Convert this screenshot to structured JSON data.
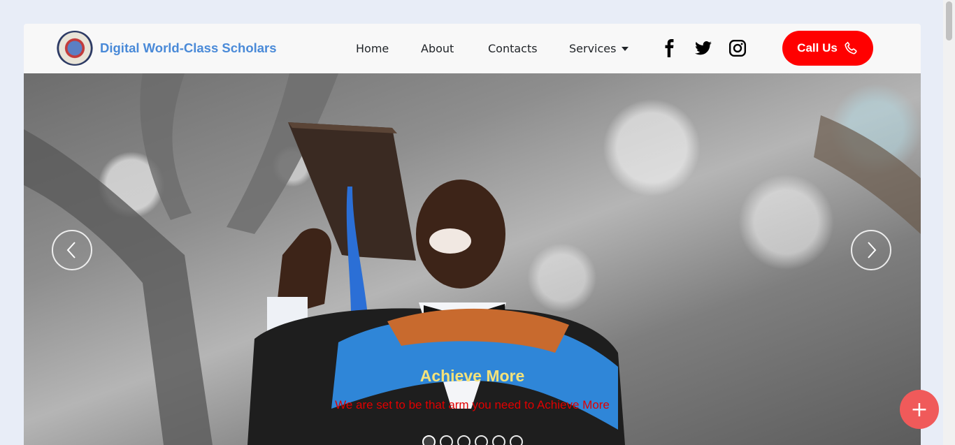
{
  "brand": {
    "name": "Digital World-Class Scholars",
    "logo_icon": "globe-seal-icon"
  },
  "nav": {
    "links": [
      {
        "label": "Home"
      },
      {
        "label": "About"
      },
      {
        "label": "Contacts"
      },
      {
        "label": "Services"
      }
    ],
    "services_dropdown_icon": "caret-down-icon",
    "social_icons": [
      "facebook-icon",
      "twitter-icon",
      "instagram-icon"
    ],
    "call_button": {
      "label": "Call Us",
      "icon": "phone-icon",
      "color": "#ff0000"
    }
  },
  "carousel": {
    "title": "Achieve More",
    "subtitle": "We are set to be that arm you need to Achieve More",
    "title_color": "#f4e27a",
    "subtitle_color": "#e00000",
    "slide_count": 6,
    "active_slide": 1,
    "prev_icon": "chevron-left-icon",
    "next_icon": "chevron-right-icon"
  },
  "fab": {
    "icon": "plus-icon",
    "label": "+",
    "color": "#f05a5a"
  },
  "colors": {
    "brand": "#4a8ad8",
    "navbar_bg": "#f8f8f8",
    "page_bg": "#e8edf7"
  }
}
